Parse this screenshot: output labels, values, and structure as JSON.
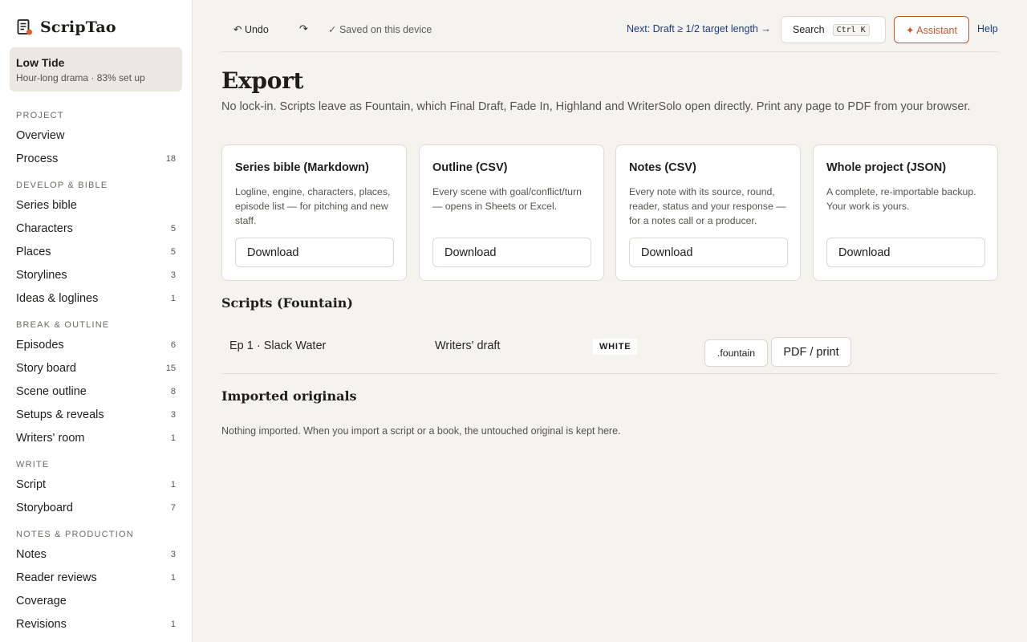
{
  "app": {
    "name": "ScripTao",
    "brand_accent": "#e05a2b"
  },
  "project": {
    "name": "Low Tide",
    "subtitle": "Hour-long drama · 83% set up"
  },
  "sidebar": {
    "sections": [
      {
        "label": "PROJECT",
        "items": [
          {
            "label": "Overview",
            "count": ""
          },
          {
            "label": "Process",
            "count": "18"
          }
        ]
      },
      {
        "label": "DEVELOP & BIBLE",
        "items": [
          {
            "label": "Series bible",
            "count": ""
          },
          {
            "label": "Characters",
            "count": "5"
          },
          {
            "label": "Places",
            "count": "5"
          },
          {
            "label": "Storylines",
            "count": "3"
          },
          {
            "label": "Ideas & loglines",
            "count": "1"
          }
        ]
      },
      {
        "label": "BREAK & OUTLINE",
        "items": [
          {
            "label": "Episodes",
            "count": "6"
          },
          {
            "label": "Story board",
            "count": "15"
          },
          {
            "label": "Scene outline",
            "count": "8"
          },
          {
            "label": "Setups & reveals",
            "count": "3"
          },
          {
            "label": "Writers' room",
            "count": "1"
          }
        ]
      },
      {
        "label": "WRITE",
        "items": [
          {
            "label": "Script",
            "count": "1"
          },
          {
            "label": "Storyboard",
            "count": "7"
          }
        ]
      },
      {
        "label": "NOTES & PRODUCTION",
        "items": [
          {
            "label": "Notes",
            "count": "3"
          },
          {
            "label": "Reader reviews",
            "count": "1"
          },
          {
            "label": "Coverage",
            "count": ""
          },
          {
            "label": "Revisions",
            "count": "1"
          }
        ]
      }
    ]
  },
  "topbar": {
    "undo_label": "↶ Undo",
    "redo_label": "↷",
    "saved_label": "✓ Saved on this device",
    "next_label": "Next: Draft ≥ 1/2 target length →",
    "search_label": "Search",
    "search_shortcut": "Ctrl K",
    "assistant_label": "✦ Assistant",
    "help_label": "Help"
  },
  "page": {
    "title": "Export",
    "description": "No lock-in. Scripts leave as Fountain, which Final Draft, Fade In, Highland and WriterSolo open directly. Print any page to PDF from your browser."
  },
  "export_cards": [
    {
      "title": "Series bible (Markdown)",
      "description": "Logline, engine, characters, places, episode list — for pitching and new staff.",
      "button": "Download"
    },
    {
      "title": "Outline (CSV)",
      "description": "Every scene with goal/conflict/turn — opens in Sheets or Excel.",
      "button": "Download"
    },
    {
      "title": "Notes (CSV)",
      "description": "Every note with its source, round, reader, status and your response — for a notes call or a producer.",
      "button": "Download"
    },
    {
      "title": "Whole project (JSON)",
      "description": "A complete, re-importable backup. Your work is yours.",
      "button": "Download"
    }
  ],
  "scripts": {
    "heading": "Scripts (Fountain)",
    "rows": [
      {
        "episode": "Ep 1 · Slack Water",
        "draft": "Writers' draft",
        "badge": "WHITE",
        "fountain_button": ".fountain",
        "pdf_button": "PDF / print"
      }
    ]
  },
  "imported": {
    "heading": "Imported originals",
    "empty_text": "Nothing imported. When you import a script or a book, the untouched original is kept here."
  }
}
